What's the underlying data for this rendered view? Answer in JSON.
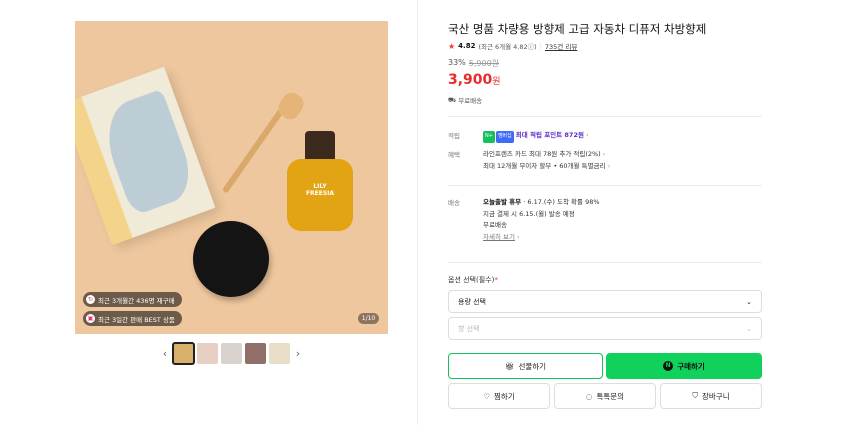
{
  "image": {
    "badges": [
      "최근 3개월간 436명 재구매",
      "최근 3일간 판매 BEST 상품"
    ],
    "counter": "1/10",
    "bottle_label": "LILY FREESIA"
  },
  "thumbnails": {
    "prev": "‹",
    "next": "›",
    "colors": [
      "#d8b06a",
      "#e8cfc3",
      "#d9d3cf",
      "#8f6f68",
      "#e9dfc8"
    ],
    "active_index": 0
  },
  "product": {
    "title": "국산 명품 차량용 방향제 고급 자동차 디퓨저 차방향제",
    "rating": "4.82",
    "rating_detail": "(최근 6개월 4.82ⓘ)",
    "review": "735건 리뷰",
    "discount": "33%",
    "original_price": "5,900원",
    "price": "3,900",
    "price_unit": "원",
    "free_shipping": "무료배송"
  },
  "benefits": {
    "points_label": "적립",
    "npay": "N+",
    "nbadge": "멤버십",
    "points_text": "최대 적립 포인트 872원",
    "benefit_label": "혜택",
    "benefit_line1": "라인프렌즈 카드 최대 78원 추가 적립(2%)",
    "benefit_line2": "최대 12개월 무이자 할부 • 60개월 특별금리"
  },
  "delivery": {
    "label": "배송",
    "type": "오늘출발 휴무",
    "eta": "· 6.17.(수) 도착 확률 98%",
    "line2": "지금 결제 시 6.15.(월) 발송 예정",
    "line3": "무료배송",
    "detail": "자세히 보기"
  },
  "options": {
    "label": "옵션 선택",
    "required": "(필수)",
    "req_mark": "*",
    "select1": "용량 선택",
    "select2": "향 선택"
  },
  "buttons": {
    "gift": "선물하기",
    "buy": "구매하기",
    "wish": "찜하기",
    "talk": "톡톡문의",
    "cart": "장바구니"
  },
  "colors": {
    "accent_green": "#0fd15b",
    "price_red": "#e82b2b",
    "point_purple": "#5b2cc9"
  }
}
